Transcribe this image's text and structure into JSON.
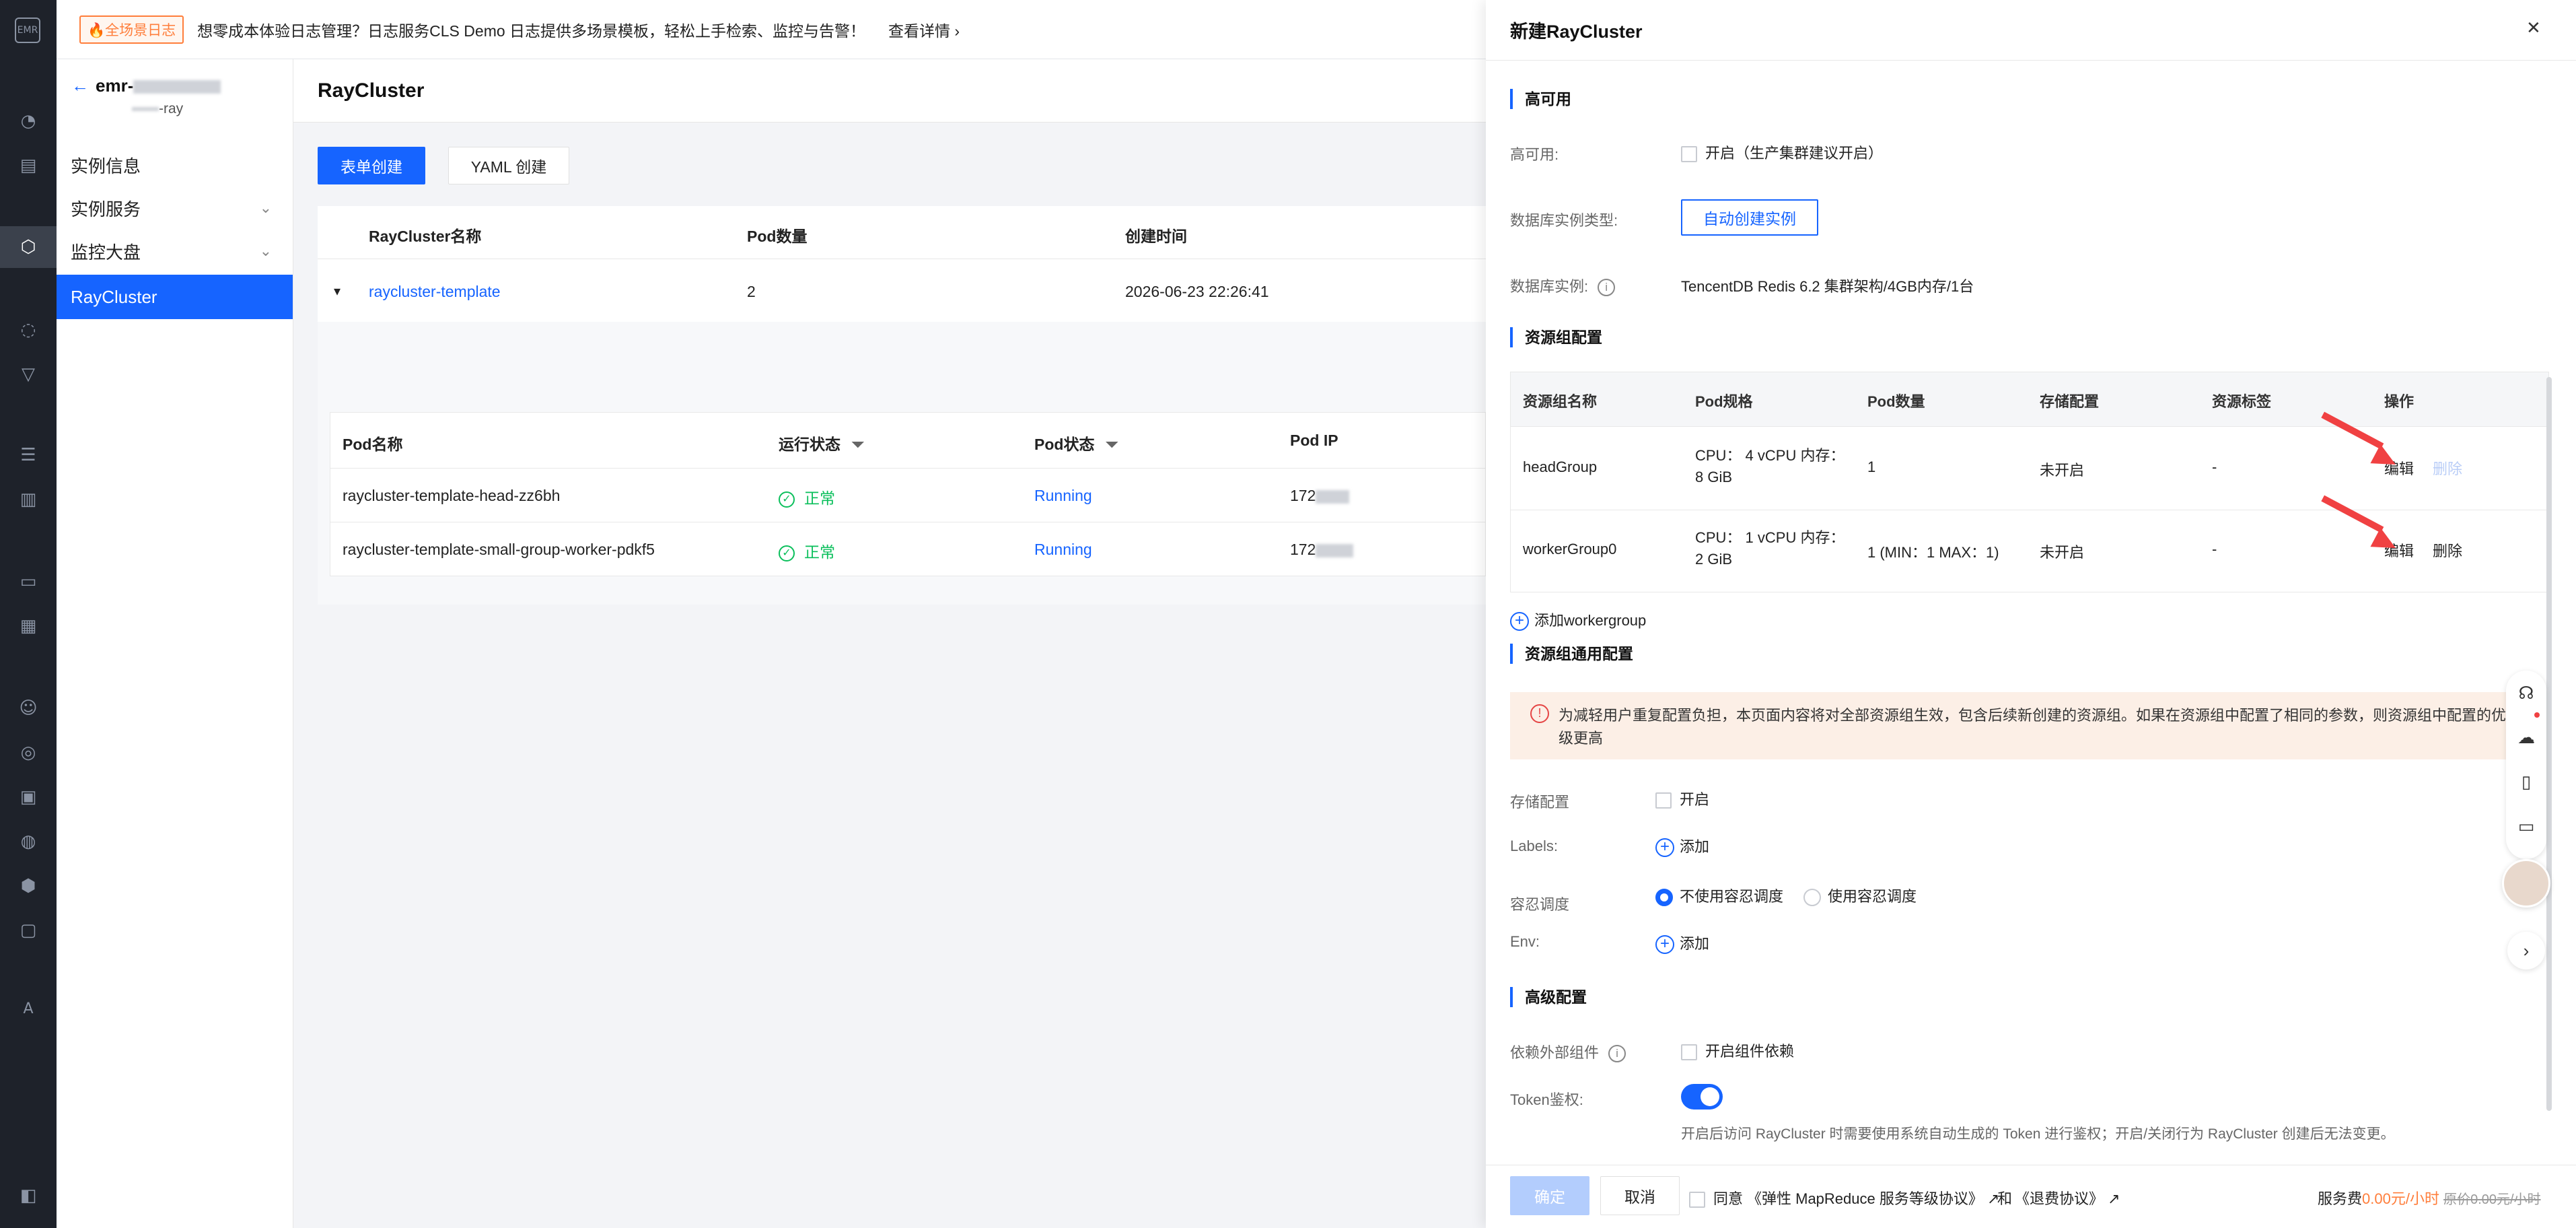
{
  "rail": {
    "logo": "EMR"
  },
  "notice": {
    "tag": "🔥全场景日志",
    "text": "想零成本体验日志管理？日志服务CLS Demo 日志提供多场景模板，轻松上手检索、监控与告警！",
    "more": "查看详情 ›"
  },
  "subnav": {
    "back_arrow": "←",
    "instance_name": "emr-",
    "instance_sub": "-ray",
    "items": [
      {
        "label": "实例信息"
      },
      {
        "label": "实例服务",
        "chevron": "⌄"
      },
      {
        "label": "监控大盘",
        "chevron": "⌄"
      },
      {
        "label": "RayCluster"
      }
    ]
  },
  "main": {
    "title": "RayCluster",
    "btn_form": "表单创建",
    "btn_yaml": "YAML 创建",
    "table_headers": [
      "RayCluster名称",
      "Pod数量",
      "创建时间"
    ],
    "row": {
      "name": "raycluster-template",
      "pods": "2",
      "created": "2026-06-23 22:26:41",
      "caret": "▾"
    },
    "pod_headers": [
      "Pod名称",
      "运行状态",
      "Pod状态",
      "Pod IP"
    ],
    "pods": [
      {
        "name": "raycluster-template-head-zz6bh",
        "status": "正常",
        "phase": "Running",
        "ip": "172"
      },
      {
        "name": "raycluster-template-small-group-worker-pdkf5",
        "status": "正常",
        "phase": "Running",
        "ip": "172"
      }
    ]
  },
  "drawer": {
    "title": "新建RayCluster",
    "close": "✕",
    "ha": {
      "section": "高可用",
      "ha_label": "高可用:",
      "ha_option": "开启（生产集群建议开启）",
      "db_type_label": "数据库实例类型:",
      "db_type_button": "自动创建实例",
      "db_instance_label": "数据库实例:",
      "db_instance_value": "TencentDB Redis 6.2 集群架构/4GB内存/1台"
    },
    "rg": {
      "section": "资源组配置",
      "headers": [
        "资源组名称",
        "Pod规格",
        "Pod数量",
        "存储配置",
        "资源标签",
        "操作"
      ],
      "rows": [
        {
          "name": "headGroup",
          "spec1": "CPU： 4 vCPU 内存：",
          "spec2": "8 GiB",
          "count": "1",
          "storage": "未开启",
          "tags": "-",
          "edit": "编辑",
          "delete": "删除"
        },
        {
          "name": "workerGroup0",
          "spec1": "CPU： 1 vCPU 内存：",
          "spec2": "2 GiB",
          "count": "1 (MIN：1 MAX：1)",
          "storage": "未开启",
          "tags": "-",
          "edit": "编辑",
          "delete": "删除"
        }
      ],
      "add": "添加workergroup"
    },
    "common": {
      "section": "资源组通用配置",
      "warning1": "为减轻用户重复配置负担，本页面内容将对全部资源组生效，包含后续新创建的资源组。如果在资源组中配置了相同的参数，则资源组中配置的优先",
      "warning2": "级更高",
      "storage_label": "存储配置",
      "storage_option": "开启",
      "labels_label": "Labels:",
      "labels_add": "添加",
      "toleration_label": "容忍调度",
      "toleration_off": "不使用容忍调度",
      "toleration_on": "使用容忍调度",
      "env_label": "Env:",
      "env_add": "添加"
    },
    "advanced": {
      "section": "高级配置",
      "dep_label": "依赖外部组件",
      "dep_option": "开启组件依赖",
      "token_label": "Token鉴权:",
      "token_enabled": true,
      "token_hint": "开启后访问 RayCluster 时需要使用系统自动生成的 Token 进行鉴权；开启/关闭行为 RayCluster 创建后无法变更。"
    },
    "footer": {
      "confirm": "确定",
      "cancel": "取消",
      "agree": "同意",
      "agreement1": "《弹性 MapReduce 服务等级协议》",
      "and": "和",
      "agreement2": "《退费协议》",
      "ext_icon": "↗",
      "fee_label": "服务费",
      "fee": "0.00元/小时",
      "orig_fee": "原价0.00元/小时"
    }
  },
  "colors": {
    "primary": "#1664ff",
    "success": "#0abf5b",
    "danger": "#f04142",
    "warning_bg": "#fcefe6",
    "orange": "#ff7e3b"
  }
}
